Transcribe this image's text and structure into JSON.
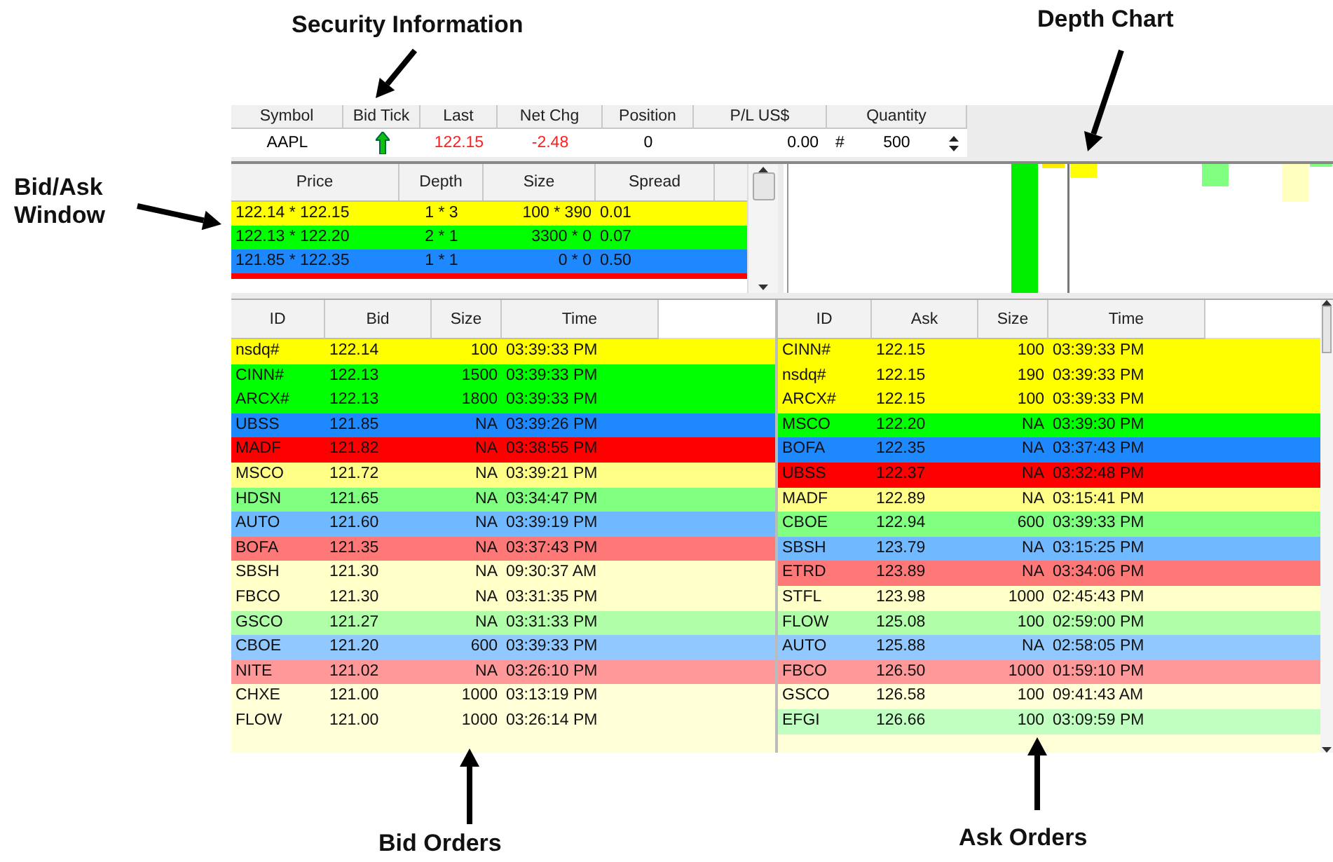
{
  "callouts": [
    "Security Information",
    "Depth Chart",
    "Bid/Ask Window",
    "Bid Orders",
    "Ask Orders"
  ],
  "security": {
    "columns": [
      "Symbol",
      "Bid Tick",
      "Last",
      "Net Chg",
      "Position",
      "P/L US$",
      "Quantity"
    ],
    "values": [
      {
        "kind": "text",
        "value": "AAPL",
        "color": "#000000"
      },
      {
        "kind": "tick",
        "up": true
      },
      {
        "kind": "text",
        "value": "122.15",
        "color": "#ff2020"
      },
      {
        "kind": "text",
        "value": "-2.48",
        "color": "#ff2020"
      },
      {
        "kind": "text",
        "value": "0",
        "color": "#000000"
      },
      {
        "kind": "text",
        "value": "0.00",
        "color": "#000000"
      },
      {
        "kind": "spinner",
        "prefix": "#",
        "value": "500"
      }
    ]
  },
  "bid_ask": {
    "columns": [
      "Price",
      "Depth",
      "Size",
      "Spread"
    ],
    "rows": [
      {
        "price": "122.14 * 122.15",
        "depth": "1 * 3",
        "size": "100 * 390",
        "spread": "0.01",
        "color": "#ffff00"
      },
      {
        "price": "122.13 * 122.20",
        "depth": "2 * 1",
        "size": "3300 * 0",
        "spread": "0.07",
        "color": "#00ff00"
      },
      {
        "price": "121.85 * 122.35",
        "depth": "1 * 1",
        "size": "0 * 0",
        "spread": "0.50",
        "color": "#1e88ff"
      },
      {
        "color": "#ff0000"
      }
    ]
  },
  "bid_orders": {
    "columns": [
      "ID",
      "Bid",
      "Size",
      "Time"
    ],
    "rows": [
      {
        "id": "nsdq#",
        "price": "122.14",
        "size": "100",
        "time": "03:39:33 PM",
        "color": "#ffff00"
      },
      {
        "id": "CINN#",
        "price": "122.13",
        "size": "1500",
        "time": "03:39:33 PM",
        "color": "#00ff00"
      },
      {
        "id": "ARCX#",
        "price": "122.13",
        "size": "1800",
        "time": "03:39:33 PM",
        "color": "#00ff00"
      },
      {
        "id": "UBSS",
        "price": "121.85",
        "size": "NA",
        "time": "03:39:26 PM",
        "color": "#1e88ff"
      },
      {
        "id": "MADF",
        "price": "121.82",
        "size": "NA",
        "time": "03:38:55 PM",
        "color": "#ff0000"
      },
      {
        "id": "MSCO",
        "price": "121.72",
        "size": "NA",
        "time": "03:39:21 PM",
        "color": "#ffff88"
      },
      {
        "id": "HDSN",
        "price": "121.65",
        "size": "NA",
        "time": "03:34:47 PM",
        "color": "#80ff80"
      },
      {
        "id": "AUTO",
        "price": "121.60",
        "size": "NA",
        "time": "03:39:19 PM",
        "color": "#70b8ff"
      },
      {
        "id": "BOFA",
        "price": "121.35",
        "size": "NA",
        "time": "03:37:43 PM",
        "color": "#ff7878"
      },
      {
        "id": "SBSH",
        "price": "121.30",
        "size": "NA",
        "time": "09:30:37 AM",
        "color": "#ffffc8"
      },
      {
        "id": "FBCO",
        "price": "121.30",
        "size": "NA",
        "time": "03:31:35 PM",
        "color": "#ffffc8"
      },
      {
        "id": "GSCO",
        "price": "121.27",
        "size": "NA",
        "time": "03:31:33 PM",
        "color": "#b0ffa8"
      },
      {
        "id": "CBOE",
        "price": "121.20",
        "size": "600",
        "time": "03:39:33 PM",
        "color": "#90c8ff"
      },
      {
        "id": "NITE",
        "price": "121.02",
        "size": "NA",
        "time": "03:26:10 PM",
        "color": "#ff9898"
      },
      {
        "id": "CHXE",
        "price": "121.00",
        "size": "1000",
        "time": "03:13:19 PM",
        "color": "#ffffd8"
      },
      {
        "id": "FLOW",
        "price": "121.00",
        "size": "1000",
        "time": "03:26:14 PM",
        "color": "#ffffd8"
      }
    ]
  },
  "ask_orders": {
    "columns": [
      "ID",
      "Ask",
      "Size",
      "Time"
    ],
    "rows": [
      {
        "id": "CINN#",
        "price": "122.15",
        "size": "100",
        "time": "03:39:33 PM",
        "color": "#ffff00"
      },
      {
        "id": "nsdq#",
        "price": "122.15",
        "size": "190",
        "time": "03:39:33 PM",
        "color": "#ffff00"
      },
      {
        "id": "ARCX#",
        "price": "122.15",
        "size": "100",
        "time": "03:39:33 PM",
        "color": "#ffff00"
      },
      {
        "id": "MSCO",
        "price": "122.20",
        "size": "NA",
        "time": "03:39:30 PM",
        "color": "#00ff00"
      },
      {
        "id": "BOFA",
        "price": "122.35",
        "size": "NA",
        "time": "03:37:43 PM",
        "color": "#1e88ff"
      },
      {
        "id": "UBSS",
        "price": "122.37",
        "size": "NA",
        "time": "03:32:48 PM",
        "color": "#ff0000"
      },
      {
        "id": "MADF",
        "price": "122.89",
        "size": "NA",
        "time": "03:15:41 PM",
        "color": "#ffff88"
      },
      {
        "id": "CBOE",
        "price": "122.94",
        "size": "600",
        "time": "03:39:33 PM",
        "color": "#80ff80"
      },
      {
        "id": "SBSH",
        "price": "123.79",
        "size": "NA",
        "time": "03:15:25 PM",
        "color": "#70b8ff"
      },
      {
        "id": "ETRD",
        "price": "123.89",
        "size": "NA",
        "time": "03:34:06 PM",
        "color": "#ff7878"
      },
      {
        "id": "STFL",
        "price": "123.98",
        "size": "1000",
        "time": "02:45:43 PM",
        "color": "#ffffc8"
      },
      {
        "id": "FLOW",
        "price": "125.08",
        "size": "100",
        "time": "02:59:00 PM",
        "color": "#b0ffa8"
      },
      {
        "id": "AUTO",
        "price": "125.88",
        "size": "NA",
        "time": "02:58:05 PM",
        "color": "#90c8ff"
      },
      {
        "id": "FBCO",
        "price": "126.50",
        "size": "1000",
        "time": "01:59:10 PM",
        "color": "#ff9898"
      },
      {
        "id": "GSCO",
        "price": "126.58",
        "size": "100",
        "time": "09:41:43 AM",
        "color": "#ffffd8"
      },
      {
        "id": "EFGI",
        "price": "126.66",
        "size": "100",
        "time": "03:09:59 PM",
        "color": "#c0ffc0"
      }
    ]
  }
}
